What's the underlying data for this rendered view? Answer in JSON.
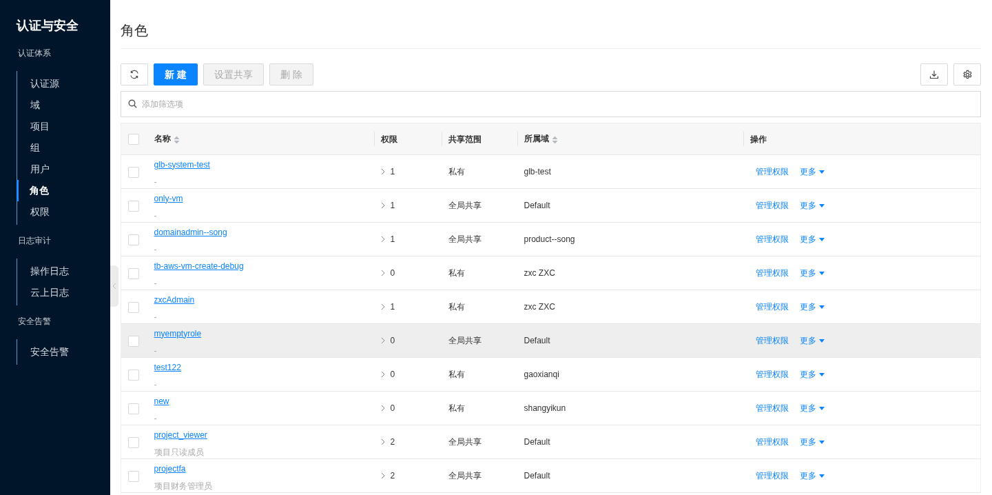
{
  "sidebar": {
    "title": "认证与安全",
    "groups": [
      {
        "label": "认证体系",
        "items": [
          {
            "label": "认证源",
            "selected": false
          },
          {
            "label": "域",
            "selected": false
          },
          {
            "label": "项目",
            "selected": false
          },
          {
            "label": "组",
            "selected": false
          },
          {
            "label": "用户",
            "selected": false
          },
          {
            "label": "角色",
            "selected": true
          },
          {
            "label": "权限",
            "selected": false
          }
        ]
      },
      {
        "label": "日志审计",
        "items": [
          {
            "label": "操作日志",
            "selected": false
          },
          {
            "label": "云上日志",
            "selected": false
          }
        ]
      },
      {
        "label": "安全告警",
        "items": [
          {
            "label": "安全告警",
            "selected": false
          }
        ]
      }
    ]
  },
  "page": {
    "title": "角色"
  },
  "toolbar": {
    "buttons": [
      {
        "label": "新 建",
        "kind": "primary",
        "disabled": false
      },
      {
        "label": "设置共享",
        "kind": "default",
        "disabled": true
      },
      {
        "label": "删 除",
        "kind": "default",
        "disabled": true
      }
    ]
  },
  "search": {
    "placeholder": "添加筛选项"
  },
  "table": {
    "columns": [
      {
        "label": "名称",
        "sortable": true
      },
      {
        "label": "权限",
        "sortable": false
      },
      {
        "label": "共享范围",
        "sortable": false
      },
      {
        "label": "所属域",
        "sortable": true
      },
      {
        "label": "操作",
        "sortable": false
      }
    ],
    "header_checked": false,
    "rows": [
      {
        "name": "glb-system-test",
        "description": "-",
        "permissions": "1",
        "scope": "私有",
        "domain": "glb-test",
        "checked": false,
        "highlighted": false,
        "actions": [
          "管理权限",
          "更多"
        ]
      },
      {
        "name": "only-vm",
        "description": "-",
        "permissions": "1",
        "scope": "全局共享",
        "domain": "Default",
        "checked": false,
        "highlighted": false,
        "actions": [
          "管理权限",
          "更多"
        ]
      },
      {
        "name": "domainadmin--song",
        "description": "-",
        "permissions": "1",
        "scope": "全局共享",
        "domain": "product--song",
        "checked": false,
        "highlighted": false,
        "actions": [
          "管理权限",
          "更多"
        ]
      },
      {
        "name": "tb-aws-vm-create-debug",
        "description": "-",
        "permissions": "0",
        "scope": "私有",
        "domain": "zxc ZXC",
        "checked": false,
        "highlighted": false,
        "actions": [
          "管理权限",
          "更多"
        ]
      },
      {
        "name": "zxcAdmain",
        "description": "-",
        "permissions": "1",
        "scope": "私有",
        "domain": "zxc ZXC",
        "checked": false,
        "highlighted": false,
        "actions": [
          "管理权限",
          "更多"
        ]
      },
      {
        "name": "myemptyrole",
        "description": "-",
        "permissions": "0",
        "scope": "全局共享",
        "domain": "Default",
        "checked": false,
        "highlighted": true,
        "actions": [
          "管理权限",
          "更多"
        ]
      },
      {
        "name": "test122",
        "description": "-",
        "permissions": "0",
        "scope": "私有",
        "domain": "gaoxianqi",
        "checked": false,
        "highlighted": false,
        "actions": [
          "管理权限",
          "更多"
        ]
      },
      {
        "name": "new",
        "description": "-",
        "permissions": "0",
        "scope": "私有",
        "domain": "shangyikun",
        "checked": false,
        "highlighted": false,
        "actions": [
          "管理权限",
          "更多"
        ]
      },
      {
        "name": "project_viewer",
        "description": "项目只读成员",
        "permissions": "2",
        "scope": "全局共享",
        "domain": "Default",
        "checked": false,
        "highlighted": false,
        "actions": [
          "管理权限",
          "更多"
        ]
      },
      {
        "name": "projectfa",
        "description": "项目财务管理员",
        "permissions": "2",
        "scope": "全局共享",
        "domain": "Default",
        "checked": false,
        "highlighted": false,
        "actions": [
          "管理权限",
          "更多"
        ]
      }
    ]
  }
}
